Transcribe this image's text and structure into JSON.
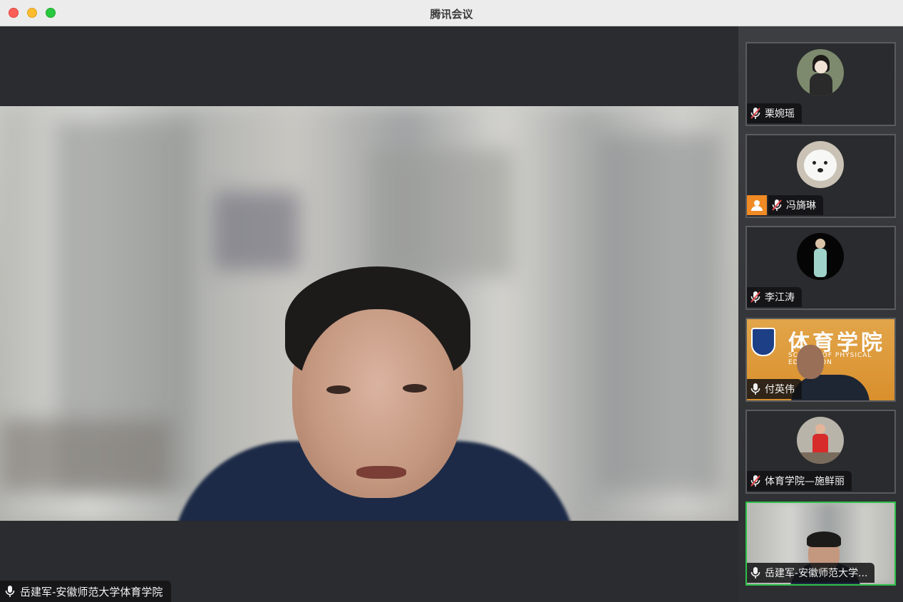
{
  "window": {
    "title": "腾讯会议"
  },
  "main": {
    "speaker_name": "岳建军-安徽师范大学体育学院",
    "speaker_mic": "mic-on-icon"
  },
  "sidebar": {
    "participants": [
      {
        "name": "栗婉瑶",
        "mic": "mic-muted-icon",
        "host": false
      },
      {
        "name": "冯旖琳",
        "mic": "mic-muted-icon",
        "host": true
      },
      {
        "name": "李江涛",
        "mic": "mic-muted-icon",
        "host": false
      },
      {
        "name": "付英伟",
        "mic": "mic-on-icon",
        "host": false,
        "video_banner": "体育学院",
        "video_banner_sub": "SCHOOL OF PHYSICAL EDUCATION"
      },
      {
        "name": "体育学院—施鲜丽",
        "mic": "mic-muted-icon",
        "host": false
      },
      {
        "name": "岳建军-安徽师范大学...",
        "mic": "mic-on-icon",
        "host": false,
        "active": true
      }
    ]
  },
  "colors": {
    "active_border": "#2fc14a",
    "host_badge": "#f08a24",
    "muted_red": "#e5484d"
  }
}
